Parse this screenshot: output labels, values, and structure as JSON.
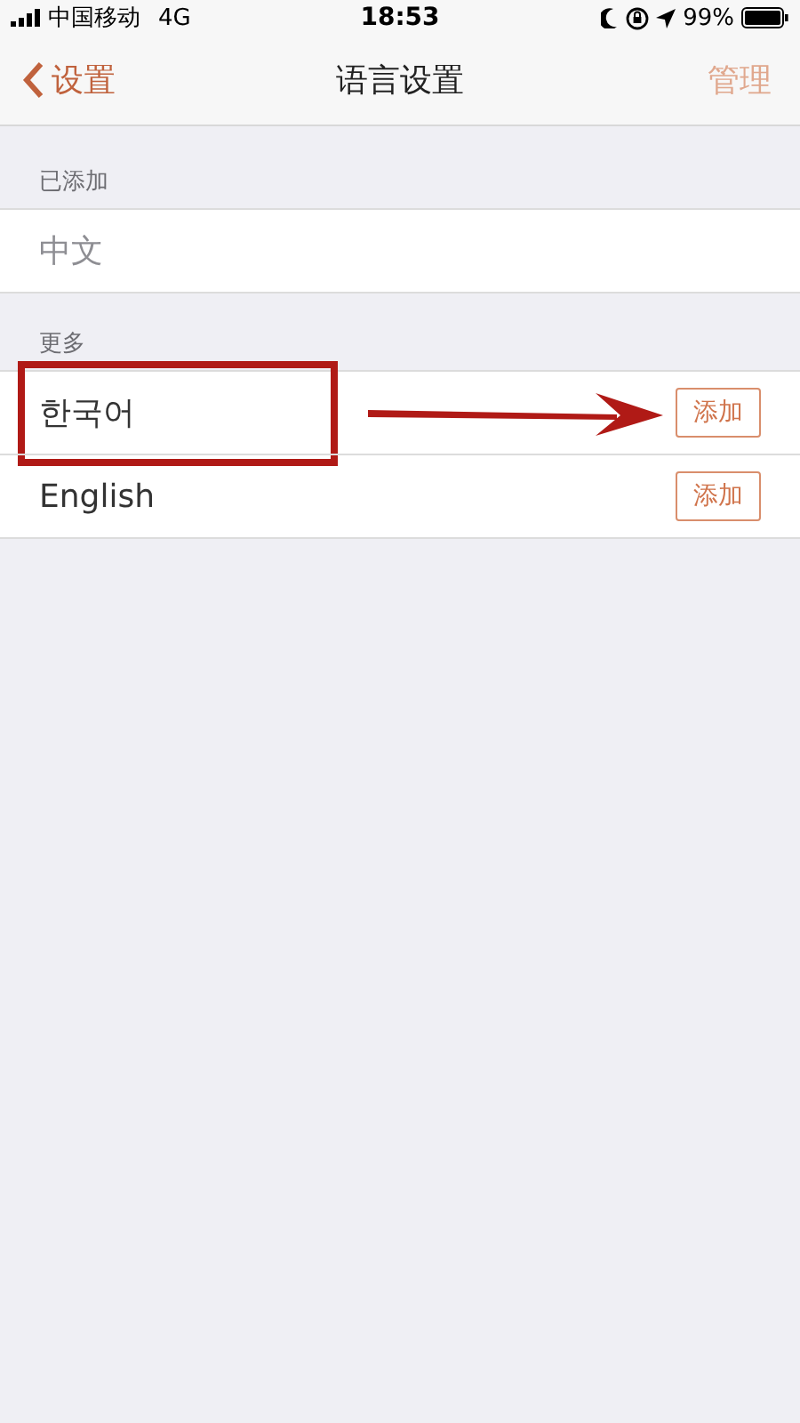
{
  "status_bar": {
    "carrier": "中国移动",
    "network": "4G",
    "time": "18:53",
    "battery": "99%"
  },
  "nav": {
    "back": "设置",
    "title": "语言设置",
    "action": {
      "label": "管理",
      "disabled": true
    }
  },
  "sections": [
    {
      "header": "已添加",
      "items": [
        {
          "name": "中文",
          "kind": "added",
          "annotated": false
        }
      ]
    },
    {
      "header": "更多",
      "items": [
        {
          "name": "한국어",
          "kind": "available",
          "button": "添加",
          "annotated": true
        },
        {
          "name": "English",
          "kind": "available",
          "button": "添加",
          "annotated": false
        }
      ]
    }
  ]
}
